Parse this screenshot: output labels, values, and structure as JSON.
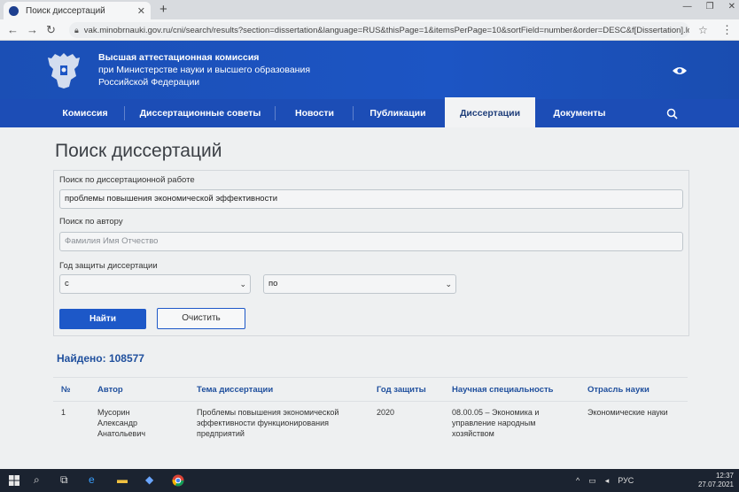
{
  "browser": {
    "tab_title": "Поиск диссертаций",
    "new_tab": "+",
    "url": "vak.minobrnauki.gov.ru/cni/search/results?section=dissertation&language=RUS&thisPage=1&itemsPerPage=10&sortField=number&order=DESC&f[Dissertation].ld..."
  },
  "header": {
    "org_line1": "Высшая аттестационная комиссия",
    "org_line2": "при Министерстве науки и высшего образования",
    "org_line3": "Российской Федерации"
  },
  "nav": {
    "items": [
      "Комиссия",
      "Диссертационные советы",
      "Новости",
      "Публикации",
      "Диссертации",
      "Документы"
    ],
    "active": "Диссертации"
  },
  "page": {
    "title": "Поиск диссертаций"
  },
  "form": {
    "work_label": "Поиск по диссертационной работе",
    "work_value": "проблемы повышения экономической эффективности",
    "author_label": "Поиск по автору",
    "author_placeholder": "Фамилия Имя Отчество",
    "year_label": "Год защиты диссертации",
    "year_from": "с",
    "year_to": "по",
    "find_button": "Найти",
    "clear_button": "Очистить"
  },
  "results": {
    "found_label": "Найдено:",
    "found_count": "108577",
    "columns": [
      "№",
      "Автор",
      "Тема диссертации",
      "Год защиты",
      "Научная специальность",
      "Отрасль науки"
    ],
    "rows": [
      {
        "num": "1",
        "author_l1": "Мусорин",
        "author_l2": "Александр",
        "author_l3": "Анатольевич",
        "topic_l1": "Проблемы повышения экономической",
        "topic_l2": "эффективности функционирования",
        "topic_l3": "предприятий",
        "year": "2020",
        "spec_l1": "08.00.05 – Экономика и",
        "spec_l2": "управление народным",
        "spec_l3": "хозяйством",
        "branch": "Экономические науки"
      }
    ]
  },
  "taskbar": {
    "lang": "РУС",
    "time": "12:37",
    "date": "27.07.2021"
  },
  "colors": {
    "header_blue": "#1c55c4",
    "nav_blue": "#1c4db6",
    "accent": "#1f4f9d",
    "button_blue": "#1d58c8"
  }
}
